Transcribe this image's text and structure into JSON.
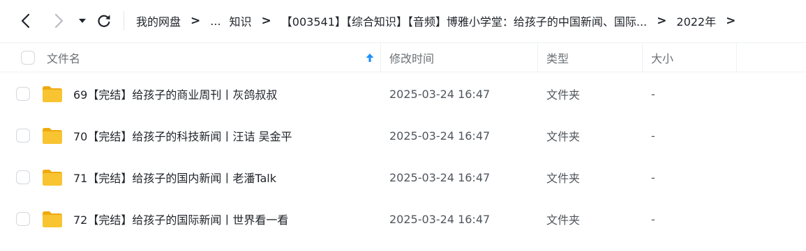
{
  "toolbar": {
    "back_icon": "chevron-left-icon",
    "forward_icon": "chevron-right-icon",
    "history_icon": "caret-down-icon",
    "refresh_icon": "refresh-icon"
  },
  "breadcrumb": {
    "items": [
      "我的网盘",
      "...",
      "知识",
      "【003541】【综合知识】【音频】博雅小学堂：给孩子的中国新闻、国际...",
      "2022年"
    ],
    "separator": ">"
  },
  "table": {
    "columns": {
      "name": "文件名",
      "modified": "修改时间",
      "type": "类型",
      "size": "大小"
    },
    "sort_icon": "arrow-up-icon",
    "rows": [
      {
        "name": "69【完结】给孩子的商业周刊丨灰鸽叔叔",
        "modified": "2025-03-24 16:47",
        "type": "文件夹",
        "size": "-"
      },
      {
        "name": "70【完结】给孩子的科技新闻丨汪诘 吴金平",
        "modified": "2025-03-24 16:47",
        "type": "文件夹",
        "size": "-"
      },
      {
        "name": "71【完结】给孩子的国内新闻丨老潘Talk",
        "modified": "2025-03-24 16:47",
        "type": "文件夹",
        "size": "-"
      },
      {
        "name": "72【完结】给孩子的国际新闻丨世界看一看",
        "modified": "2025-03-24 16:47",
        "type": "文件夹",
        "size": "-"
      }
    ]
  },
  "colors": {
    "accent": "#1e90ff",
    "folder": "#f8c431",
    "folder_dark": "#eeaa10"
  }
}
